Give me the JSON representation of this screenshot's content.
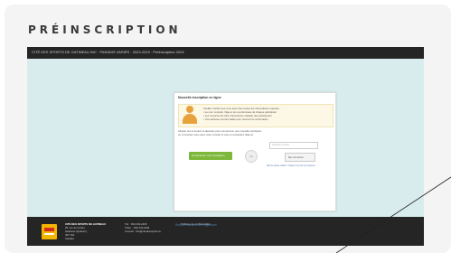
{
  "page": {
    "heading": "PRÉINSCRIPTION"
  },
  "screenshot": {
    "topbar_text": "CITÉ DES SPORTS DE GATINEAU INC · PARADIS VARIÉS · 2023-2024 · Préinscription 2024",
    "panel_title": "Nouvelle inscription en ligne",
    "notice_lines": [
      "Veuillez vérifier que vous avez bien toutes les informations requises :",
      "• Le nom complet, l'âge et les coordonnées de chaque participant",
      "• Les numéros de carte d'assurance maladie des participants",
      "• Une adresse courriel valide pour recevoir la confirmation"
    ],
    "intro_lines": [
      "Cliquez sur le bouton ci-dessous pour commencer une nouvelle inscription,",
      "ou connectez-vous avec votre compte si vous en possédez déjà un."
    ],
    "start_button": "Commencer une inscription",
    "or_label": "ou",
    "login_placeholder": "Adresse courriel",
    "login_button": "Me connecter",
    "forgot_link": "Mot de passe oublié ? Cliquez ici pour le récupérer",
    "return_link": "Retour à l'accueil de l'organisme",
    "footer": {
      "org_lines": [
        "CITÉ DES SPORTS DE GATINEAU",
        "25, rue du Centre",
        "Gatineau (Québec)",
        "J8Y 2S1",
        "Canada"
      ],
      "contact_lines": [
        "Tél. : 819 243-2345",
        "Téléc. : 819 243-2346",
        "Courriel : info@citedessports.ca"
      ],
      "link_lines": [
        "Politique de confidentialité"
      ]
    }
  },
  "colors": {
    "topbar": "#252525",
    "background": "#d9eced",
    "accent_green": "#7db83a",
    "avatar_orange": "#e8a23c",
    "link_blue": "#4a7fb0"
  },
  "icons": {
    "user": "user-silhouette-icon",
    "logo": "organization-logo"
  }
}
